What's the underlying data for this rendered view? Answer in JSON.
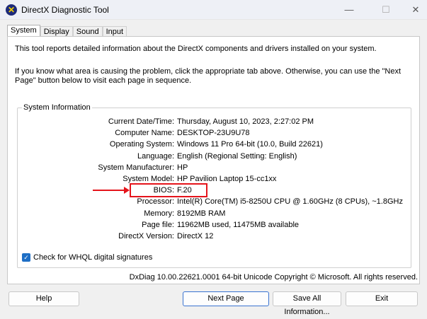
{
  "window": {
    "title": "DirectX Diagnostic Tool",
    "minimize": "—",
    "maximize": "☐",
    "close": "✕"
  },
  "tabs": [
    "System",
    "Display",
    "Sound",
    "Input"
  ],
  "intro": "This tool reports detailed information about the DirectX components and drivers installed on your system.",
  "instructions": "If you know what area is causing the problem, click the appropriate tab above.  Otherwise, you can use the \"Next Page\" button below to visit each page in sequence.",
  "system_info": {
    "title": "System Information",
    "rows": [
      {
        "label": "Current Date/Time:",
        "value": "Thursday, August 10, 2023, 2:27:02 PM"
      },
      {
        "label": "Computer Name:",
        "value": "DESKTOP-23U9U78"
      },
      {
        "label": "Operating System:",
        "value": "Windows 11 Pro 64-bit (10.0, Build 22621)"
      },
      {
        "label": "Language:",
        "value": "English (Regional Setting: English)"
      },
      {
        "label": "System Manufacturer:",
        "value": "HP"
      },
      {
        "label": "System Model:",
        "value": "HP Pavilion Laptop 15-cc1xx"
      },
      {
        "label": "BIOS:",
        "value": "F.20"
      },
      {
        "label": "Processor:",
        "value": "Intel(R) Core(TM) i5-8250U CPU @ 1.60GHz (8 CPUs), ~1.8GHz"
      },
      {
        "label": "Memory:",
        "value": "8192MB RAM"
      },
      {
        "label": "Page file:",
        "value": "11962MB used, 11475MB available"
      },
      {
        "label": "DirectX Version:",
        "value": "DirectX 12"
      }
    ]
  },
  "whql": {
    "label": "Check for WHQL digital signatures",
    "checked": true
  },
  "footer": "DxDiag 10.00.22621.0001 64-bit Unicode  Copyright © Microsoft. All rights reserved.",
  "buttons": {
    "help": "Help",
    "next": "Next Page",
    "save": "Save All Information...",
    "exit": "Exit"
  }
}
